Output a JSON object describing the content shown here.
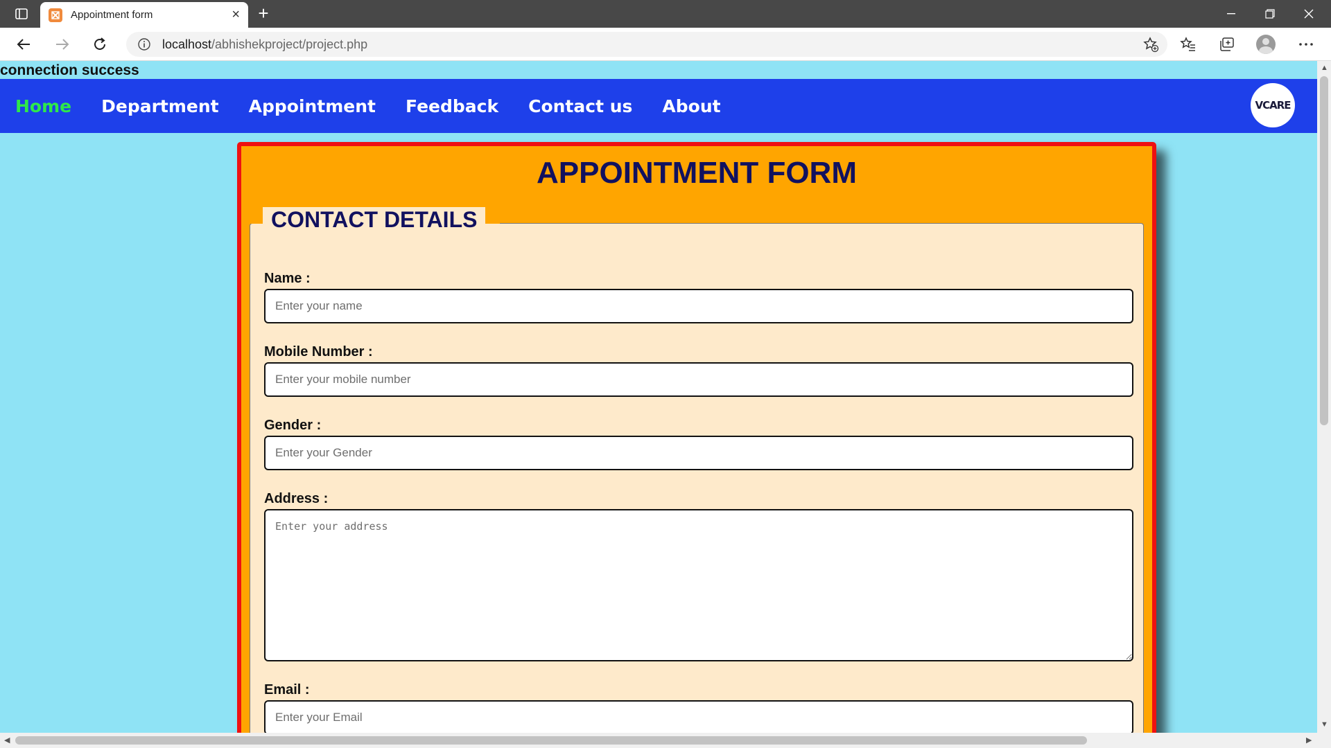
{
  "browser": {
    "tab_title": "Appointment form",
    "url_host": "localhost",
    "url_path": "/abhishekproject/project.php"
  },
  "page": {
    "status_text": "connection success",
    "nav": [
      {
        "label": "Home",
        "active": true
      },
      {
        "label": "Department"
      },
      {
        "label": "Appointment"
      },
      {
        "label": "Feedback"
      },
      {
        "label": "Contact us"
      },
      {
        "label": "About"
      }
    ],
    "logo_text": "VCARE",
    "form": {
      "title": "APPOINTMENT FORM",
      "legend": "CONTACT DETAILS",
      "fields": [
        {
          "label": "Name :",
          "placeholder": "Enter your name"
        },
        {
          "label": "Mobile Number :",
          "placeholder": "Enter your mobile number"
        },
        {
          "label": "Gender :",
          "placeholder": "Enter your Gender"
        },
        {
          "label": "Address :",
          "placeholder": "Enter your address"
        },
        {
          "label": "Email :",
          "placeholder": "Enter your Email"
        }
      ]
    }
  },
  "colors": {
    "page_bg": "#8fe3f5",
    "navbar": "#1e40ea",
    "nav_active": "#2ee84a",
    "card_bg": "#ffa500",
    "card_border": "#ee1111",
    "fieldset_bg": "#feeacb",
    "heading": "#11115f"
  },
  "icons": [
    "tab-actions-icon",
    "favicon-icon",
    "close-icon",
    "plus-icon",
    "minimize-icon",
    "restore-icon",
    "window-close-icon",
    "back-arrow-icon",
    "forward-arrow-icon",
    "reload-icon",
    "info-icon",
    "add-favorite-icon",
    "favorites-icon",
    "collections-icon",
    "profile-icon",
    "more-icon"
  ]
}
